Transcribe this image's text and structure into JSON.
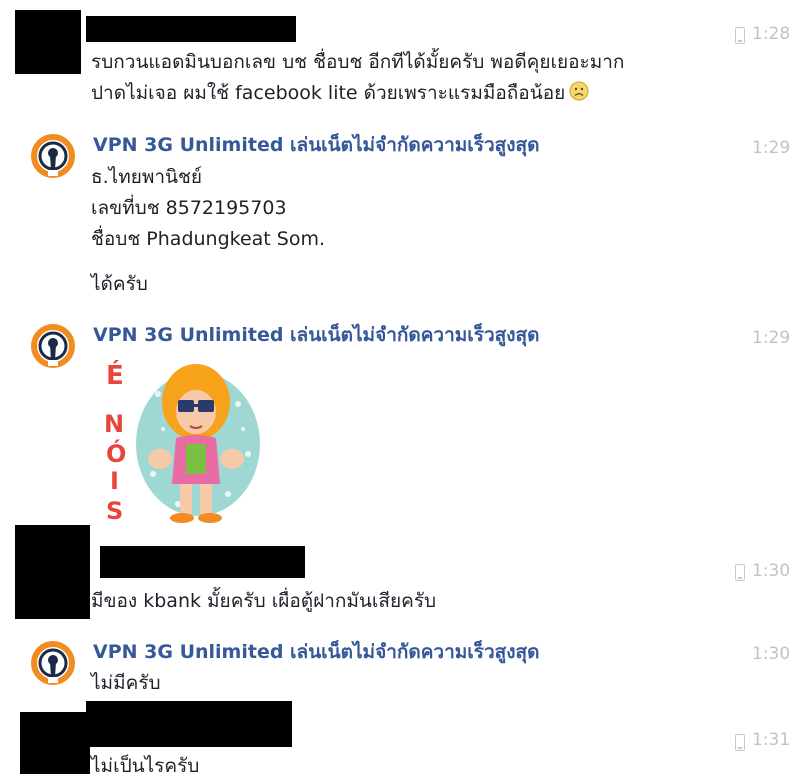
{
  "messages": [
    {
      "sender": "",
      "lines": [
        "รบกวนแอดมินบอกเลข บช ชื่อบช อีกทีได้มั้ยครับ พอดีคุยเยอะมาก",
        "ปาดไม่เจอ ผมใช้ facebook lite ด้วยเพราะแรมมือถือน้อย"
      ],
      "emoji": "frowning-face-emoji",
      "time": "1:28",
      "mobile": true
    },
    {
      "sender": "VPN 3G Unlimited เล่นเน็ตไม่จำกัดความเร็วสูงสุด",
      "lines": [
        "ธ.ไทยพานิชย์",
        "เลขที่บช 8572195703",
        "ชื่อบช Phadungkeat Som."
      ],
      "followup": "ได้ครับ",
      "time": "1:29",
      "mobile": false
    },
    {
      "sender": "VPN 3G Unlimited เล่นเน็ตไม่จำกัดความเร็วสูงสุด",
      "sticker_text": "É NÓIS",
      "time": "1:29",
      "mobile": false
    },
    {
      "sender": "",
      "lines": [
        "มีของ kbank มั้ยครับ เผื่อตู้ฝากมันเสียครับ"
      ],
      "time": "1:30",
      "mobile": true
    },
    {
      "sender": "VPN 3G Unlimited เล่นเน็ตไม่จำกัดความเร็วสูงสุด",
      "lines": [
        "ไม่มีครับ"
      ],
      "time": "1:30",
      "mobile": false
    },
    {
      "sender": "",
      "lines": [
        "ไม่เป็นไรครับ"
      ],
      "time": "1:31",
      "mobile": true
    }
  ],
  "colors": {
    "sender": "#365899",
    "text": "#1d2129",
    "time": "#bec2c9",
    "vpn_orange": "#f28c20",
    "vpn_dark": "#1b2a47"
  },
  "icons": {
    "vpn_avatar": "openvpn-logo-icon",
    "mobile_indicator": "mobile-phone-icon"
  }
}
